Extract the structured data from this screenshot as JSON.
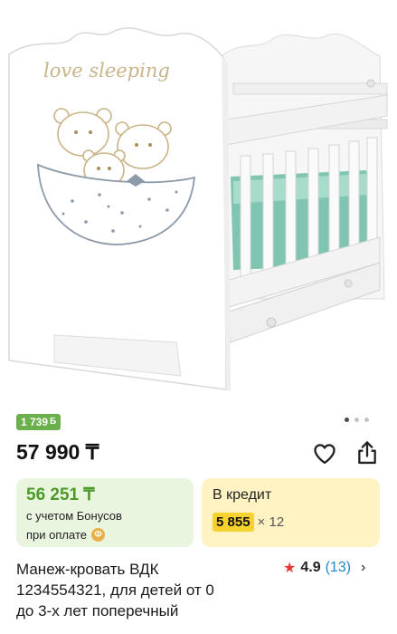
{
  "product_image": {
    "decal_text": "love sleeping"
  },
  "carousel": {
    "count": 3,
    "active": 0
  },
  "bonus_badge": {
    "amount": "1 739",
    "symbol": "Б"
  },
  "price": "57 990 ₸",
  "bonus_card": {
    "price": "56 251 ₸",
    "note_line1": "с учетом Бонусов",
    "note_line2": "при оплате",
    "coin_glyph": "Ф"
  },
  "credit_card": {
    "label": "В кредит",
    "monthly": "5 855",
    "months": "× 12"
  },
  "title": {
    "line1": "Манеж-кровать ВДК",
    "line2": "1234554321, для детей от 0",
    "line3": "до 3-х лет поперечный"
  },
  "rating": {
    "score": "4.9",
    "count": "(13)"
  },
  "colors": {
    "bonus_green": "#4c9a2a",
    "badge_green": "#6ab04c",
    "credit_yellow": "#f7d12e",
    "star_red": "#e53935",
    "link_blue": "#1e88c9"
  },
  "icons": [
    "heart-icon",
    "share-icon",
    "star-icon",
    "chevron-right-icon"
  ]
}
